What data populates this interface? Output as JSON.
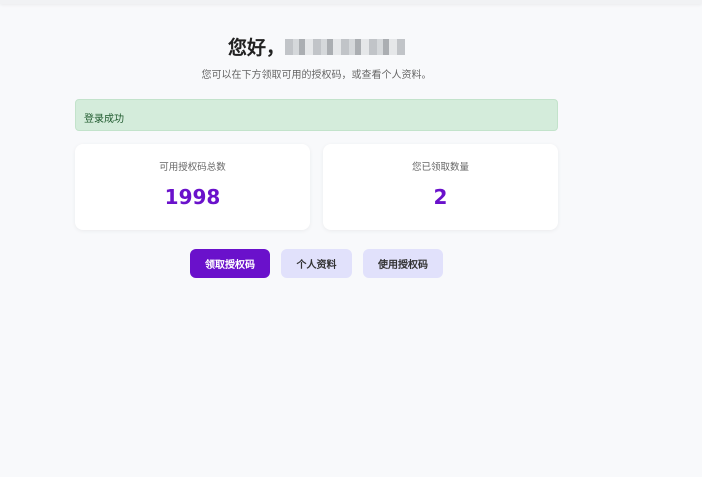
{
  "header": {
    "greeting": "您好，",
    "subtitle": "您可以在下方领取可用的授权码，或查看个人资料。"
  },
  "alert": {
    "message": "登录成功"
  },
  "stats": [
    {
      "label": "可用授权码总数",
      "value": "1998"
    },
    {
      "label": "您已领取数量",
      "value": "2"
    }
  ],
  "actions": {
    "claim": "领取授权码",
    "profile": "个人资料",
    "use": "使用授权码"
  },
  "colors": {
    "accent": "#6a11cb",
    "secondary": "#e1e1fb",
    "success_bg": "#d4ecdb"
  }
}
